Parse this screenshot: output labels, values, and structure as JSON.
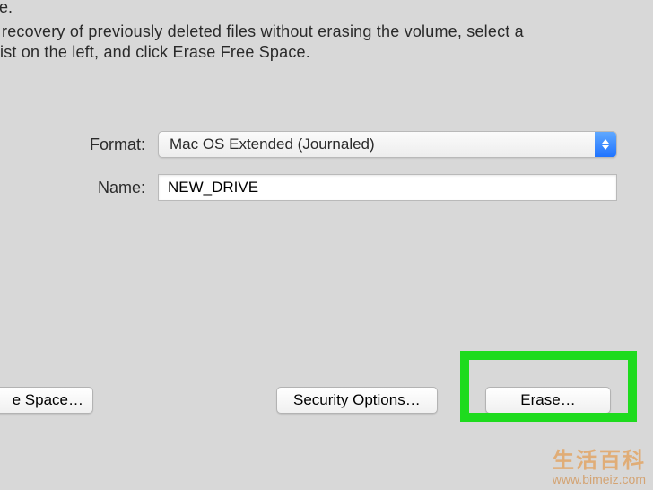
{
  "topText": {
    "cutoff": "se.",
    "line1": " recovery of previously deleted files without erasing the volume, select a",
    "line2": "ist on the left, and click Erase Free Space."
  },
  "form": {
    "formatLabel": "Format:",
    "formatValue": "Mac OS Extended (Journaled)",
    "nameLabel": "Name:",
    "nameValue": "NEW_DRIVE"
  },
  "buttons": {
    "freeSpace": "e Space…",
    "securityOptions": "Security Options…",
    "erase": "Erase…"
  },
  "watermark": {
    "chinese": "生活百科",
    "url": "www.bimeiz.com"
  }
}
